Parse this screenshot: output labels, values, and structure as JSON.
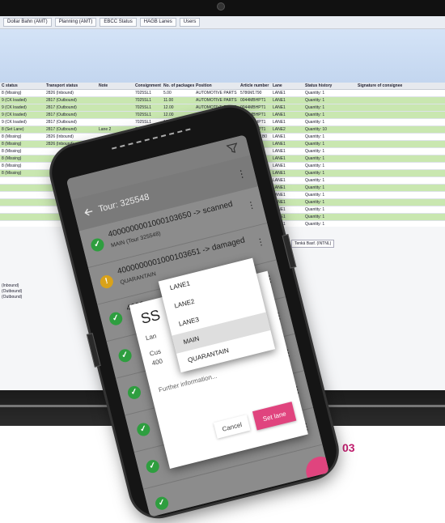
{
  "toolbar": {
    "buttons": [
      "Dollar Bahn (AMT)",
      "Planning (AMT)",
      "EBCC Status",
      "HAGB Lanes",
      "Users"
    ]
  },
  "grid": {
    "headers": [
      "C status",
      "Transport status",
      "Note",
      "Consignment",
      "No. of packages",
      "Position",
      "Article number",
      "Lane",
      "Status history",
      "Signature of consignee"
    ],
    "rows": [
      [
        "8 (Missing)",
        "2826 (Inbound)",
        "",
        "7025SL1",
        "5.00",
        "AUTOMOTIVE PARTS",
        "5786M1790",
        "LANE1",
        "Quantity: 1",
        ""
      ],
      [
        "9 (CK loaded)",
        "2817 (Outbound)",
        "",
        "7025SL1",
        "11.00",
        "AUTOMOTIVE PARTS",
        "0044MBHPT1",
        "LANE1",
        "Quantity: 1",
        ""
      ],
      [
        "9 (CK loaded)",
        "2817 (Outbound)",
        "",
        "7025SL1",
        "12.00",
        "AUTOMOTIVE PARTS",
        "0044MBHPT1",
        "LANE1",
        "Quantity: 1",
        ""
      ],
      [
        "9 (CK loaded)",
        "2817 (Outbound)",
        "",
        "7025SL1",
        "12.00",
        "AUTOMOTIVE PARTS",
        "0044MBHPT1",
        "LANE1",
        "Quantity: 1",
        ""
      ],
      [
        "9 (CK loaded)",
        "2817 (Outbound)",
        "",
        "7025SL1",
        "12.00",
        "AUTOMOTIVE PARTS",
        "0044MBHPT1",
        "LANE1",
        "Quantity: 1",
        ""
      ],
      [
        "8 (Set Lane)",
        "2817 (Outbound)",
        "Lane 2",
        "7025SL1",
        "12.00",
        "AUTOMOTIVE PARTS",
        "0044MBHPT1",
        "LANE2",
        "Quantity: 10",
        ""
      ],
      [
        "8 (Missing)",
        "2826 (Inbound)",
        "",
        "7025SL1",
        "",
        "AUTOMOTIVE PARTS",
        "0021DB1B1B0",
        "LANE1",
        "Quantity: 1",
        ""
      ],
      [
        "8 (Missing)",
        "2826 (Inbound)",
        "",
        "",
        "",
        "",
        "",
        "LANE1",
        "Quantity: 1",
        ""
      ],
      [
        "8 (Missing)",
        "",
        "",
        "",
        "",
        "",
        "",
        "LANE1",
        "Quantity: 1",
        ""
      ],
      [
        "8 (Missing)",
        "",
        "",
        "",
        "",
        "",
        "",
        "LANE1",
        "Quantity: 1",
        ""
      ],
      [
        "8 (Missing)",
        "",
        "",
        "",
        "",
        "",
        "",
        "LANE1",
        "Quantity: 1",
        ""
      ],
      [
        "8 (Missing)",
        "",
        "",
        "",
        "",
        "",
        "",
        "LANE1",
        "Quantity: 1",
        ""
      ],
      [
        "",
        "",
        "",
        "",
        "",
        "",
        "",
        "LANE1",
        "Quantity: 1",
        ""
      ],
      [
        "",
        "",
        "",
        "",
        "",
        "",
        "",
        "LANE1",
        "Quantity: 1",
        ""
      ],
      [
        "",
        "",
        "",
        "",
        "",
        "",
        "",
        "LANE1",
        "Quantity: 1",
        ""
      ],
      [
        "",
        "",
        "",
        "",
        "",
        "",
        "",
        "LANE1",
        "Quantity: 1",
        ""
      ],
      [
        "",
        "",
        "",
        "",
        "",
        "",
        "",
        "LANE1",
        "Quantity: 1",
        ""
      ],
      [
        "",
        "",
        "",
        "",
        "",
        "",
        "",
        "LANE1",
        "Quantity: 1",
        ""
      ],
      [
        "",
        "",
        "",
        "",
        "",
        "",
        "",
        "LANE1",
        "Quantity: 1",
        ""
      ],
      [
        "",
        "",
        "",
        "",
        "",
        "",
        "",
        "LANE1",
        "Quantity: 1",
        ""
      ]
    ],
    "row_styles": [
      "white",
      "green",
      "green",
      "green",
      "white",
      "green",
      "white",
      "green",
      "white",
      "green",
      "white",
      "green",
      "white",
      "green",
      "white",
      "green",
      "white",
      "green",
      "white",
      "green"
    ]
  },
  "lower_panel": {
    "left_rows": [
      "(Inbound)",
      "(Outbound)",
      "(Outbound)"
    ],
    "filter_text": "Tenkä Basf. (INTNL)"
  },
  "phone": {
    "tour_title": "Tour: 325548",
    "items": [
      {
        "status": "ok",
        "title": "4000000001000103650 -> scanned",
        "sub": "MAIN (Tour 325548)"
      },
      {
        "status": "warn",
        "title": "4000000001000103651 -> damaged",
        "sub": "QUARANTAIN"
      },
      {
        "status": "ok",
        "title": "4000",
        "sub": ""
      },
      {
        "status": "ok",
        "title": "",
        "sub": ""
      },
      {
        "status": "ok",
        "title": "",
        "sub": ""
      },
      {
        "status": "ok",
        "title": "",
        "sub": ""
      },
      {
        "status": "ok",
        "title": "",
        "sub": ""
      },
      {
        "status": "ok",
        "title": "",
        "sub": ""
      }
    ],
    "dialog": {
      "title": "SS",
      "lane_label": "Lan",
      "cust_label": "Cus",
      "number": "400",
      "further_info": "Further information...",
      "cancel_label": "Cancel",
      "set_lane_label": "Set lane"
    },
    "dropdown_options": [
      "LANE1",
      "LANE2",
      "LANE3",
      "MAIN",
      "QUARANTAIN"
    ],
    "dropdown_selected_index": 3,
    "accent_color": "#e0447e"
  },
  "page_number": "03"
}
